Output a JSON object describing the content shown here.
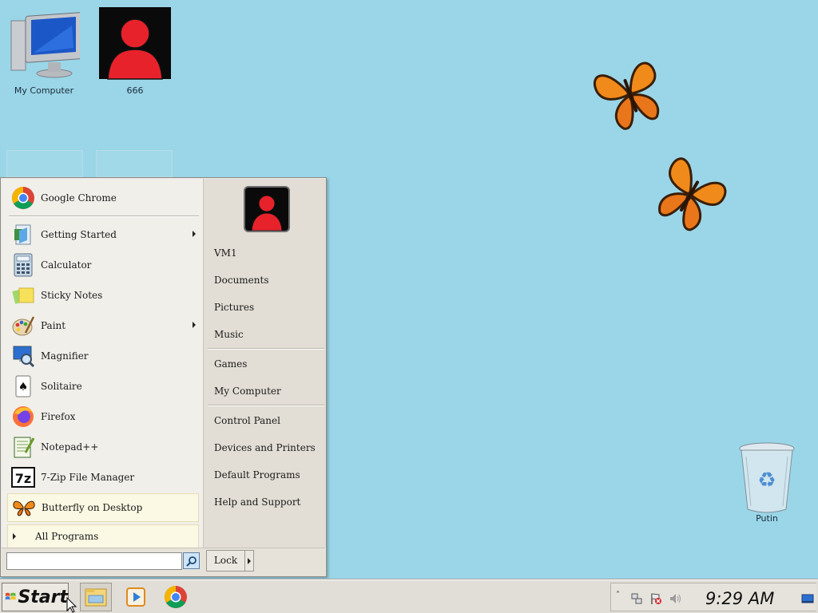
{
  "desktop": {
    "icons": [
      {
        "label": "My Computer"
      },
      {
        "label": "666"
      },
      {
        "label": "Putin"
      }
    ]
  },
  "start_menu": {
    "pinned": {
      "label": "Google Chrome"
    },
    "programs": [
      {
        "label": "Getting Started",
        "has_submenu": true
      },
      {
        "label": "Calculator"
      },
      {
        "label": "Sticky Notes"
      },
      {
        "label": "Paint",
        "has_submenu": true
      },
      {
        "label": "Magnifier"
      },
      {
        "label": "Solitaire"
      },
      {
        "label": "Firefox"
      },
      {
        "label": "Notepad++"
      },
      {
        "label": "7-Zip File Manager"
      },
      {
        "label": "Butterfly on Desktop"
      }
    ],
    "all_programs": "All Programs",
    "search_placeholder": "",
    "right": {
      "user": "VM1",
      "documents": "Documents",
      "pictures": "Pictures",
      "music": "Music",
      "games": "Games",
      "my_computer": "My Computer",
      "control_panel": "Control Panel",
      "devices": "Devices and Printers",
      "default_programs": "Default Programs",
      "help": "Help and Support"
    },
    "lock_label": "Lock"
  },
  "taskbar": {
    "start_label": "Start",
    "clock": "9:29 AM",
    "tray_chevron": "˄"
  },
  "colors": {
    "desktop_bg": "#9ad6e8",
    "menu_bg": "#ebe8e1",
    "highlight": "#fbf8e3"
  }
}
